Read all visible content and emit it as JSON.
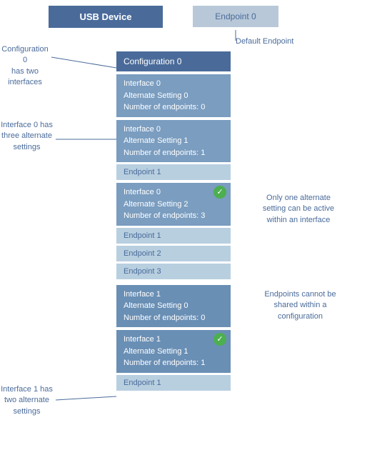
{
  "header": {
    "usb_device_label": "USB Device",
    "endpoint0_label": "Endpoint 0",
    "default_endpoint_label": "Default Endpoint"
  },
  "annotations": {
    "config0": "Configuration 0\nhas two\ninterfaces",
    "interface0_settings": "Interface 0 has\nthree alternate\nsettings",
    "interface1_settings": "Interface 1 has\ntwo alternate\nsettings",
    "only_one_alternate": "Only one alternate\nsetting can be active\nwithin an interface",
    "endpoints_cannot": "Endpoints cannot be\nshared within a\nconfiguration"
  },
  "config": {
    "label": "Configuration 0"
  },
  "interfaces": [
    {
      "name": "Interface 0",
      "setting": "Alternate Setting 0",
      "endpoints": "Number of endpoints: 0",
      "active": false,
      "endpoint_list": []
    },
    {
      "name": "Interface 0",
      "setting": "Alternate Setting 1",
      "endpoints": "Number of endpoints: 1",
      "active": false,
      "endpoint_list": [
        "Endpoint 1"
      ]
    },
    {
      "name": "Interface 0",
      "setting": "Alternate Setting 2",
      "endpoints": "Number of endpoints: 3",
      "active": true,
      "endpoint_list": [
        "Endpoint 1",
        "Endpoint 2",
        "Endpoint 3"
      ]
    },
    {
      "name": "Interface 1",
      "setting": "Alternate Setting 0",
      "endpoints": "Number of endpoints: 0",
      "active": false,
      "endpoint_list": []
    },
    {
      "name": "Interface 1",
      "setting": "Alternate Setting 1",
      "endpoints": "Number of endpoints: 1",
      "active": true,
      "endpoint_list": [
        "Endpoint 1"
      ]
    }
  ]
}
